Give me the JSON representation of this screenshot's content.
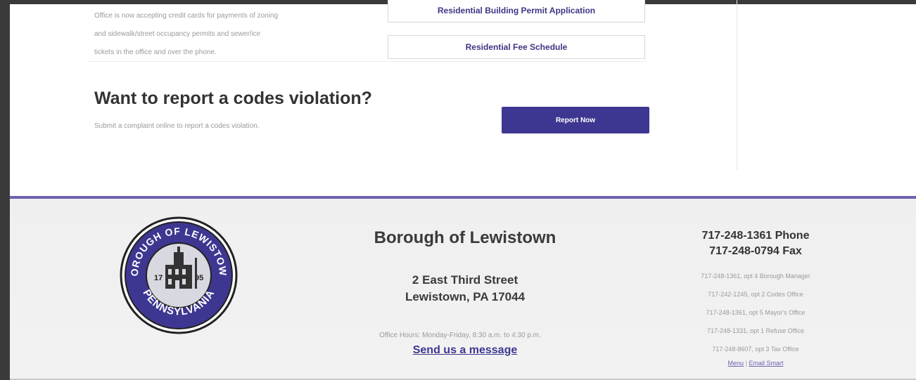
{
  "services": {
    "notice_lines": [
      "Office is now accepting credit cards for payments of zoning",
      "and sidewalk/street occupancy permits and sewer/ice",
      "tickets in the office and over the phone."
    ],
    "buttons": [
      {
        "label": "Residential Building Permit Application"
      },
      {
        "label": "Residential Fee Schedule"
      }
    ]
  },
  "report": {
    "heading": "Want to report a codes violation?",
    "subtext": "Submit a complaint online to report a codes violation.",
    "button_label": "Report Now"
  },
  "footer": {
    "seal": {
      "top_text": "BOROUGH OF LEWISTOWN",
      "bottom_text": "PENNSYLVANIA",
      "year_left": "17",
      "year_right": "95",
      "ring_color": "#3e3791"
    },
    "title": "Borough of Lewistown",
    "address_line1": "2 East Third Street",
    "address_line2": "Lewistown, PA 17044",
    "office_hours": "Office Hours: Monday-Friday, 8:30 a.m. to 4:30 p.m.",
    "contact_link": "Send us a message",
    "phone": "717-248-1361 Phone",
    "fax": "717-248-0794 Fax",
    "extensions": [
      "717-248-1361, opt 4 Borough Manager",
      "717-242-1245, opt 2 Codes Office",
      "717-248-1361, opt 5 Mayor's Office",
      "717-248-1331, opt 1 Refuse Office",
      "717-248-8607, opt 3 Tax Office"
    ],
    "links": [
      "Menu",
      "Email Smart"
    ],
    "link_separator": "|"
  },
  "colors": {
    "brand_purple": "#3e3791",
    "accent_line": "#6e62b0"
  }
}
